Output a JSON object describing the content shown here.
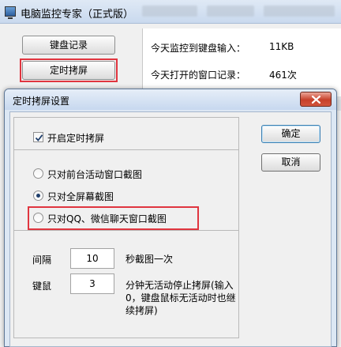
{
  "main_window": {
    "title": "电脑监控专家（正式版）",
    "buttons": {
      "keyboard_log": "键盘记录",
      "timed_capture": "定时拷屏"
    },
    "stats": [
      {
        "label": "今天监控到键盘输入：",
        "value": "11KB"
      },
      {
        "label": "今天打开的窗口记录：",
        "value": "461次"
      }
    ]
  },
  "dialog": {
    "title": "定时拷屏设置",
    "enable_checkbox": {
      "label": "开启定时拷屏",
      "checked": true
    },
    "capture_modes": [
      {
        "label": "只对前台活动窗口截图",
        "selected": false
      },
      {
        "label": "只对全屏幕截图",
        "selected": true
      },
      {
        "label": "只对QQ、微信聊天窗口截图",
        "selected": false
      }
    ],
    "interval": {
      "label": "间隔",
      "value": "10",
      "unit": "秒截图一次"
    },
    "idle": {
      "label": "键鼠",
      "value": "3",
      "description": "分钟无活动停止拷屏(输入0，键盘鼠标无活动时也继续拷屏)"
    },
    "ok_label": "确定",
    "cancel_label": "取消"
  },
  "colors": {
    "highlight_red": "#e0353f",
    "close_button": "#c7402a",
    "title_bar": "#c7d8ef"
  }
}
